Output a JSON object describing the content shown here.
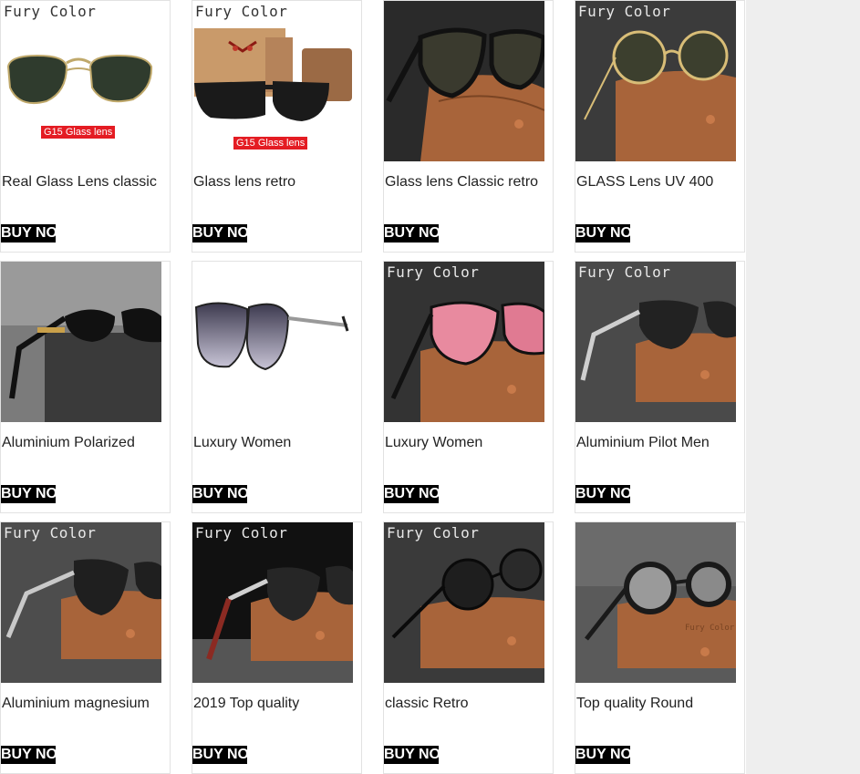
{
  "products": [
    {
      "brand": "Fury Color",
      "title": "Real Glass Lens classic",
      "tag": "G15 Glass lens",
      "buy": "BUY NOW"
    },
    {
      "brand": "Fury Color",
      "title": "Glass lens retro",
      "tag": "G15 Glass lens",
      "buy": "BUY NOW"
    },
    {
      "brand": "",
      "title": "Glass lens Classic retro",
      "tag": "",
      "buy": "BUY NOW"
    },
    {
      "brand": "Fury Color",
      "title": "GLASS Lens UV 400",
      "tag": "",
      "buy": "BUY NOW"
    },
    {
      "brand": "",
      "title": "Aluminium Polarized",
      "tag": "",
      "buy": "BUY NOW"
    },
    {
      "brand": "",
      "title": "Luxury Women",
      "tag": "",
      "buy": "BUY NOW"
    },
    {
      "brand": "Fury Color",
      "title": "Luxury Women",
      "tag": "",
      "buy": "BUY NOW"
    },
    {
      "brand": "Fury Color",
      "title": "Aluminium Pilot Men",
      "tag": "",
      "buy": "BUY NOW"
    },
    {
      "brand": "Fury Color",
      "title": "Aluminium magnesium",
      "tag": "",
      "buy": "BUY NOW"
    },
    {
      "brand": "Fury Color",
      "title": "2019 Top quality",
      "tag": "",
      "buy": "BUY NOW"
    },
    {
      "brand": "Fury Color",
      "title": "classic Retro",
      "tag": "",
      "buy": "BUY NOW"
    },
    {
      "brand": "",
      "title": "Top quality Round",
      "tag": "",
      "buy": "BUY NOW"
    }
  ],
  "case_label": "Fury Color",
  "colors": {
    "buy_bg": "#000000",
    "buy_text": "#ffffff",
    "tag_red": "#e41c23",
    "case_brown": "#a8643a",
    "gutter": "#eeeeee"
  }
}
